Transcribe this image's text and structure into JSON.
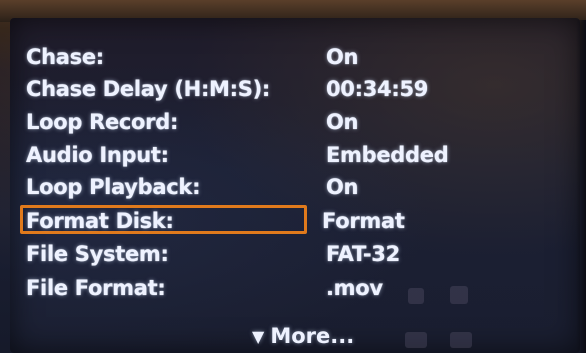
{
  "menu": {
    "items": [
      {
        "label": "Chase:",
        "value": "On"
      },
      {
        "label": "Chase Delay (H:M:S):",
        "value": "00:34:59"
      },
      {
        "label": "Loop Record:",
        "value": "On"
      },
      {
        "label": "Audio Input:",
        "value": "Embedded"
      },
      {
        "label": "Loop Playback:",
        "value": "On"
      },
      {
        "label": "Format Disk:",
        "value": "Format",
        "selected": true
      },
      {
        "label": "File System:",
        "value": "FAT-32"
      },
      {
        "label": "File Format:",
        "value": ".mov"
      }
    ],
    "more_label": "More...",
    "more_icon": "triangle-down-icon"
  },
  "colors": {
    "text": "#eef2ff",
    "selection": "#e07a1c",
    "screen": "#1c2034"
  }
}
